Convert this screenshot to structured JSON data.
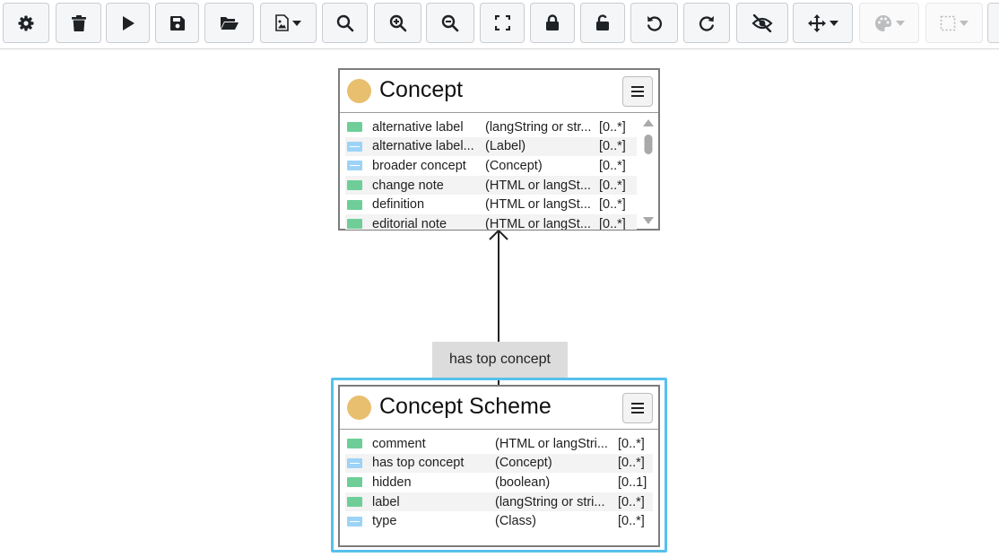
{
  "toolbar": {
    "buttons": [
      {
        "name": "settings-button",
        "icon": "gear-icon",
        "enabled": true
      },
      {
        "name": "delete-button",
        "icon": "trash-icon",
        "enabled": true
      },
      {
        "name": "run-button",
        "icon": "play-icon",
        "enabled": true
      },
      {
        "name": "save-button",
        "icon": "floppy-icon",
        "enabled": true
      },
      {
        "name": "open-button",
        "icon": "folder-open-icon",
        "enabled": true
      },
      {
        "name": "export-image-button",
        "icon": "file-image-icon",
        "enabled": true,
        "dropdown": true
      },
      {
        "name": "search-button",
        "icon": "search-icon",
        "enabled": true
      },
      {
        "name": "zoom-in-button",
        "icon": "zoom-in-icon",
        "enabled": true
      },
      {
        "name": "zoom-out-button",
        "icon": "zoom-out-icon",
        "enabled": true
      },
      {
        "name": "fit-view-button",
        "icon": "expand-icon",
        "enabled": true
      },
      {
        "name": "lock-button",
        "icon": "lock-icon",
        "enabled": true
      },
      {
        "name": "unlock-button",
        "icon": "unlock-icon",
        "enabled": true
      },
      {
        "name": "undo-button",
        "icon": "undo-icon",
        "enabled": true
      },
      {
        "name": "redo-button",
        "icon": "redo-icon",
        "enabled": true
      },
      {
        "name": "hide-button",
        "icon": "eye-slash-icon",
        "enabled": true
      },
      {
        "name": "move-button",
        "icon": "arrows-move-icon",
        "enabled": true,
        "dropdown": true
      },
      {
        "name": "color-button",
        "icon": "palette-icon",
        "enabled": false,
        "dropdown": true
      },
      {
        "name": "border-style-button",
        "icon": "dashed-square-icon",
        "enabled": false,
        "dropdown": true
      }
    ]
  },
  "colors": {
    "class_dot": "#e8bf6e",
    "attribute_icon": "#6fce98",
    "relation_icon": "#9dd3f6",
    "selection": "#56c1ec",
    "edge_label_bg": "#dcdcdc"
  },
  "classes": {
    "concept": {
      "title": "Concept",
      "properties": [
        {
          "icon": "attribute",
          "name": "alternative label",
          "range": "(langString or str...",
          "card": "[0..*]"
        },
        {
          "icon": "relation",
          "name": "alternative label...",
          "range": "(Label)",
          "card": "[0..*]"
        },
        {
          "icon": "relation",
          "name": "broader concept",
          "range": "(Concept)",
          "card": "[0..*]"
        },
        {
          "icon": "attribute",
          "name": "change note",
          "range": "(HTML or langSt...",
          "card": "[0..*]"
        },
        {
          "icon": "attribute",
          "name": "definition",
          "range": "(HTML or langSt...",
          "card": "[0..*]"
        },
        {
          "icon": "attribute",
          "name": "editorial note",
          "range": "(HTML or langSt...",
          "card": "[0..*]"
        }
      ]
    },
    "concept_scheme": {
      "title": "Concept Scheme",
      "properties": [
        {
          "icon": "attribute",
          "name": "comment",
          "range": "(HTML or langStri...",
          "card": "[0..*]"
        },
        {
          "icon": "relation",
          "name": "has top concept",
          "range": "(Concept)",
          "card": "[0..*]"
        },
        {
          "icon": "attribute",
          "name": "hidden",
          "range": "(boolean)",
          "card": "[0..1]"
        },
        {
          "icon": "attribute",
          "name": "label",
          "range": "(langString or stri...",
          "card": "[0..*]"
        },
        {
          "icon": "relation",
          "name": "type",
          "range": "(Class)",
          "card": "[0..*]"
        }
      ]
    }
  },
  "edge": {
    "label": "has top concept"
  }
}
